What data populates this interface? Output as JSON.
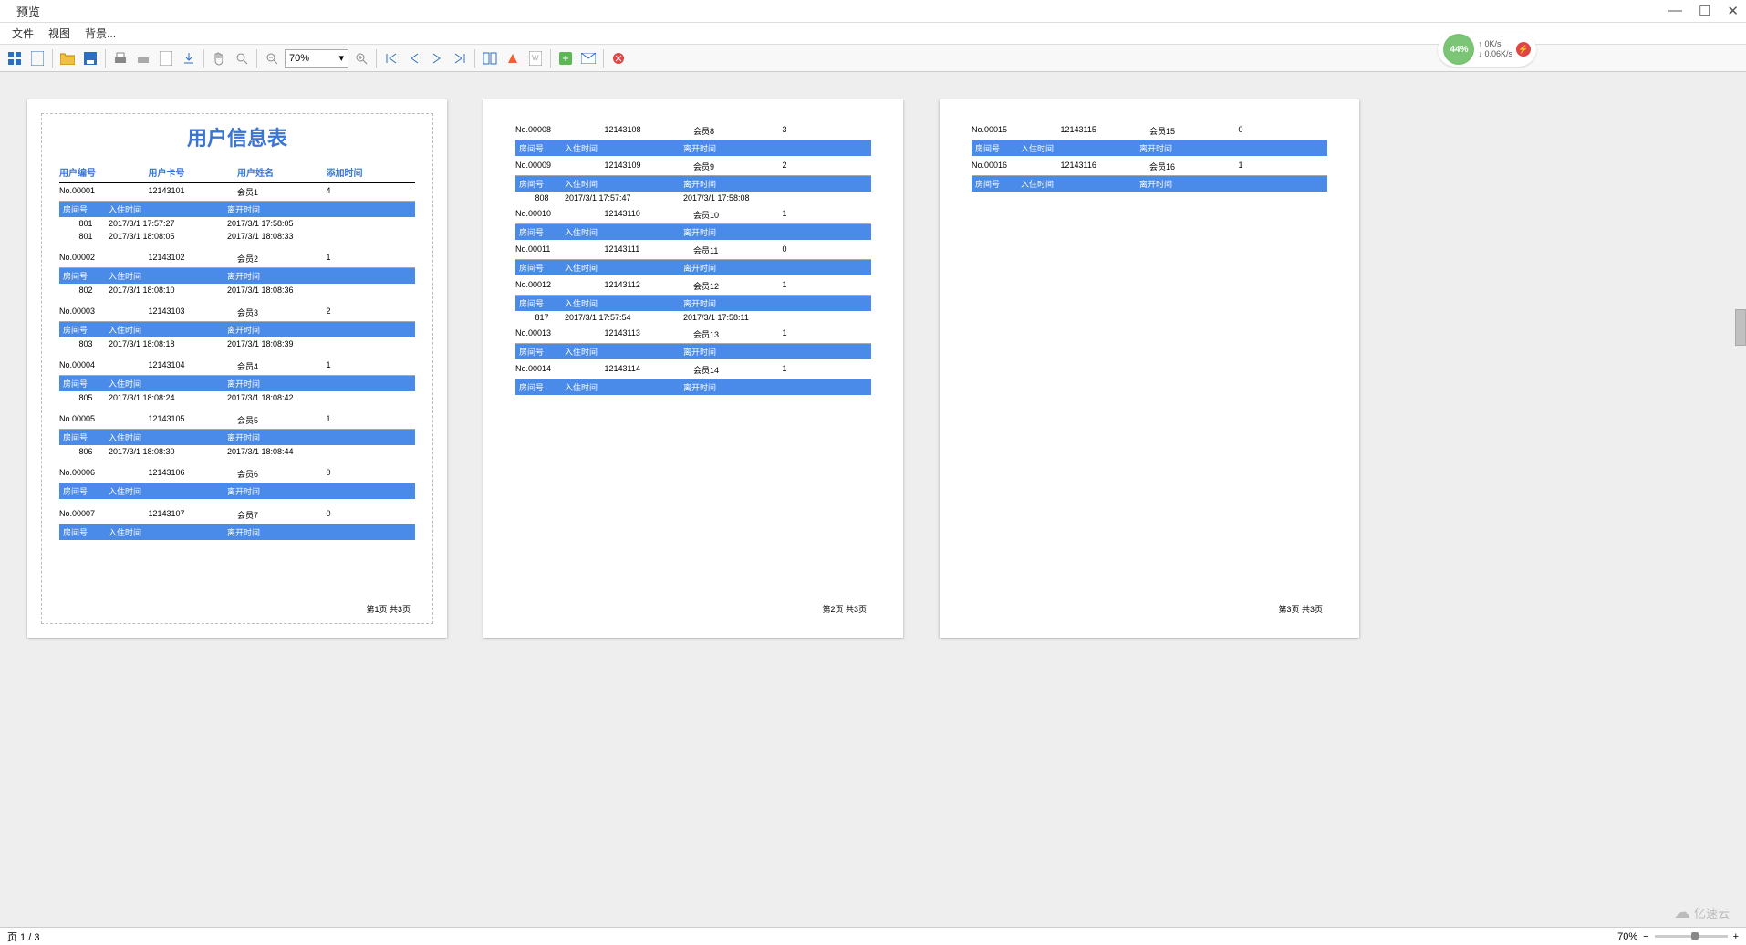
{
  "window": {
    "title": "预览",
    "min": "—",
    "max": "☐",
    "close": "✕"
  },
  "menubar": {
    "file": "文件",
    "view": "视图",
    "background": "背景..."
  },
  "toolbar": {
    "zoom_value": "70%"
  },
  "net_widget": {
    "percent": "44%",
    "up": "↑ 0K/s",
    "down": "↓ 0.06K/s"
  },
  "report": {
    "title": "用户信息表",
    "cols": {
      "c1": "用户编号",
      "c2": "用户卡号",
      "c3": "用户姓名",
      "c4": "添加时间"
    },
    "subcols": {
      "s1": "房间号",
      "s2": "入住时间",
      "s3": "离开时间"
    },
    "pages": [
      {
        "footer": "第1页  共3页",
        "records": [
          {
            "no": "No.00001",
            "card": "12143101",
            "name": "会员1",
            "cnt": "4",
            "rows": [
              {
                "room": "801",
                "in": "2017/3/1 17:57:27",
                "out": "2017/3/1 17:58:05"
              },
              {
                "room": "801",
                "in": "2017/3/1 18:08:05",
                "out": "2017/3/1 18:08:33"
              }
            ]
          },
          {
            "no": "No.00002",
            "card": "12143102",
            "name": "会员2",
            "cnt": "1",
            "rows": [
              {
                "room": "802",
                "in": "2017/3/1 18:08:10",
                "out": "2017/3/1 18:08:36"
              }
            ]
          },
          {
            "no": "No.00003",
            "card": "12143103",
            "name": "会员3",
            "cnt": "2",
            "rows": [
              {
                "room": "803",
                "in": "2017/3/1 18:08:18",
                "out": "2017/3/1 18:08:39"
              }
            ]
          },
          {
            "no": "No.00004",
            "card": "12143104",
            "name": "会员4",
            "cnt": "1",
            "rows": [
              {
                "room": "805",
                "in": "2017/3/1 18:08:24",
                "out": "2017/3/1 18:08:42"
              }
            ]
          },
          {
            "no": "No.00005",
            "card": "12143105",
            "name": "会员5",
            "cnt": "1",
            "rows": [
              {
                "room": "806",
                "in": "2017/3/1 18:08:30",
                "out": "2017/3/1 18:08:44"
              }
            ]
          },
          {
            "no": "No.00006",
            "card": "12143106",
            "name": "会员6",
            "cnt": "0",
            "rows": []
          },
          {
            "no": "No.00007",
            "card": "12143107",
            "name": "会员7",
            "cnt": "0",
            "rows": []
          }
        ]
      },
      {
        "footer": "第2页  共3页",
        "records": [
          {
            "no": "No.00008",
            "card": "12143108",
            "name": "会员8",
            "cnt": "3",
            "rows": [],
            "header_only": true
          },
          {
            "no": "No.00009",
            "card": "12143109",
            "name": "会员9",
            "cnt": "2",
            "rows": [
              {
                "room": "808",
                "in": "2017/3/1 17:57:47",
                "out": "2017/3/1 17:58:08"
              }
            ]
          },
          {
            "no": "No.00010",
            "card": "12143110",
            "name": "会员10",
            "cnt": "1",
            "rows": []
          },
          {
            "no": "No.00011",
            "card": "12143111",
            "name": "会员11",
            "cnt": "0",
            "rows": []
          },
          {
            "no": "No.00012",
            "card": "12143112",
            "name": "会员12",
            "cnt": "1",
            "rows": [
              {
                "room": "817",
                "in": "2017/3/1 17:57:54",
                "out": "2017/3/1 17:58:11"
              }
            ]
          },
          {
            "no": "No.00013",
            "card": "12143113",
            "name": "会员13",
            "cnt": "1",
            "rows": []
          },
          {
            "no": "No.00014",
            "card": "12143114",
            "name": "会员14",
            "cnt": "1",
            "rows": []
          }
        ]
      },
      {
        "footer": "第3页  共3页",
        "records": [
          {
            "no": "No.00015",
            "card": "12143115",
            "name": "会员15",
            "cnt": "0",
            "rows": []
          },
          {
            "no": "No.00016",
            "card": "12143116",
            "name": "会员16",
            "cnt": "1",
            "rows": []
          }
        ]
      }
    ]
  },
  "statusbar": {
    "page": "页 1 / 3",
    "zoom": "70%"
  },
  "watermark": "亿速云"
}
